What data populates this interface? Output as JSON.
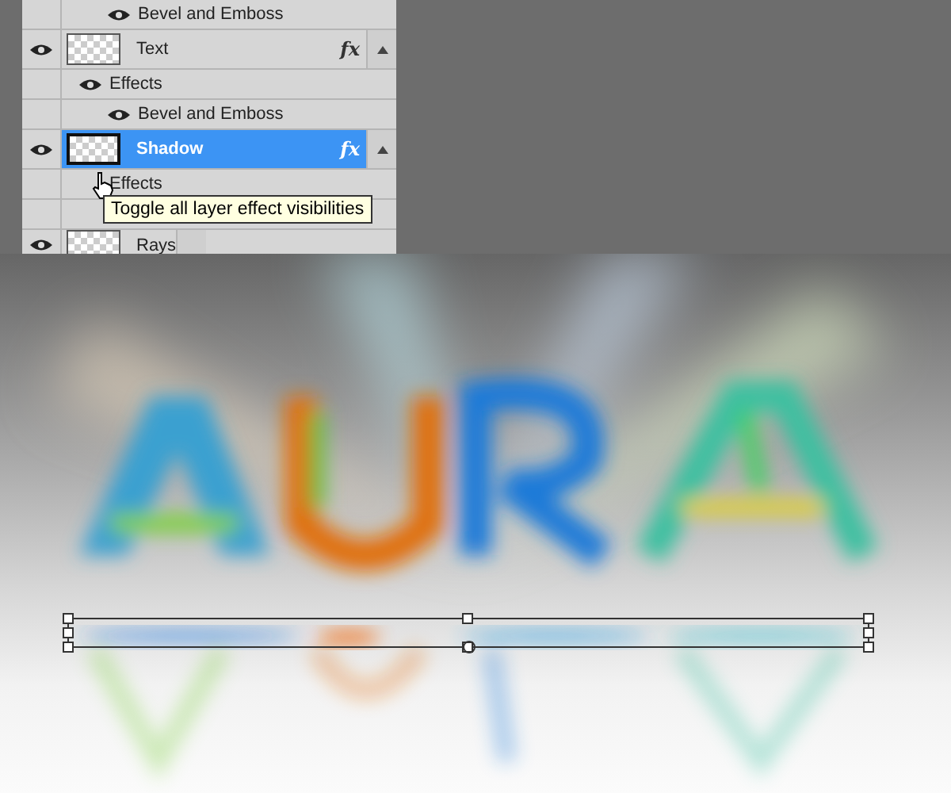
{
  "layers_panel": {
    "rows": [
      {
        "kind": "effect",
        "label": "Bevel and Emboss",
        "visible": true
      },
      {
        "kind": "layer",
        "label": "Text",
        "selected": false,
        "visible": true,
        "fx": "fx"
      },
      {
        "kind": "group",
        "label": "Effects",
        "visible": true
      },
      {
        "kind": "effect",
        "label": "Bevel and Emboss",
        "visible": true
      },
      {
        "kind": "layer",
        "label": "Shadow",
        "selected": true,
        "visible": true,
        "fx": "fx"
      },
      {
        "kind": "group",
        "label": "Effects",
        "visible": false
      },
      {
        "kind": "blank"
      },
      {
        "kind": "layer",
        "label": "Rays",
        "selected": false,
        "visible": true
      }
    ]
  },
  "tooltip": {
    "text": "Toggle all layer effect visibilities"
  }
}
